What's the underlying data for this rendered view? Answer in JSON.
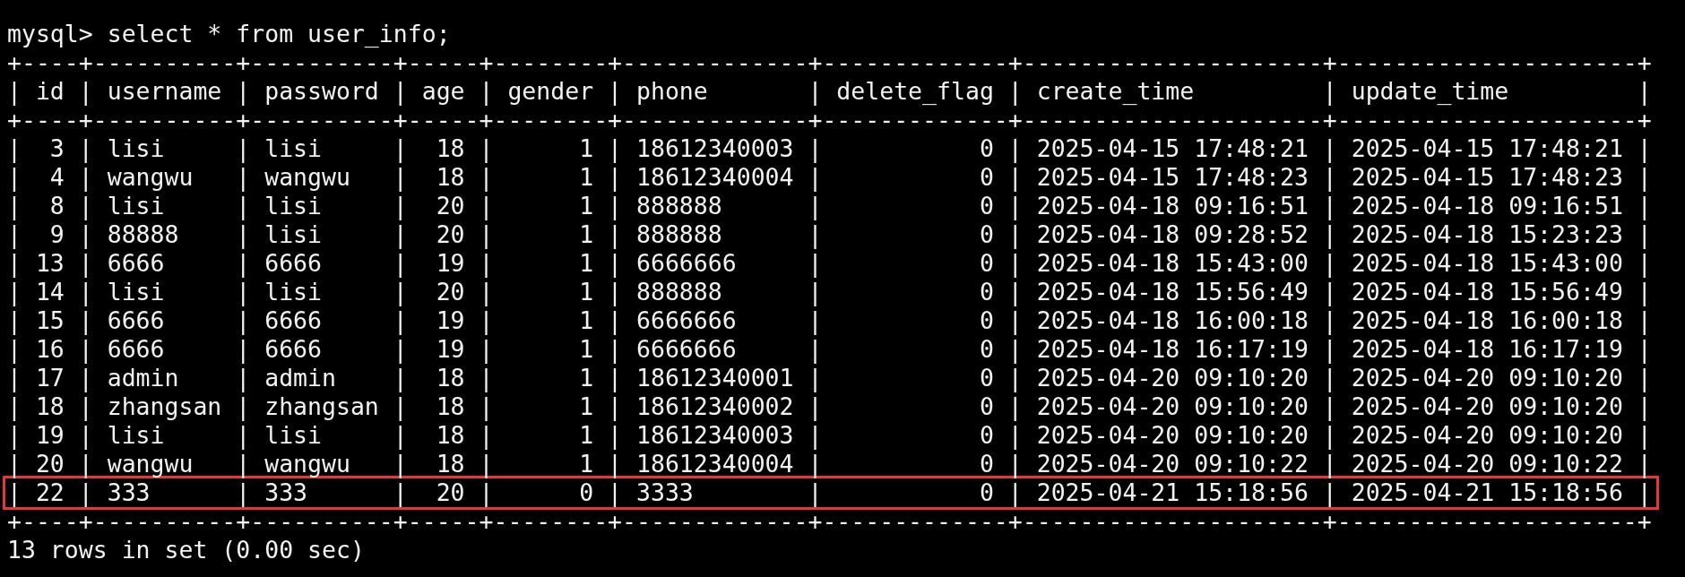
{
  "prompt": "mysql> select * from user_info;",
  "table": {
    "separator_char": "|",
    "top_border": "+----+----------+----------+-----+--------+-------------+-------------+---------------------+---------------------+",
    "header_border": "+----+----------+----------+-----+--------+-------------+-------------+---------------------+---------------------+",
    "bottom_border": "+----+----------+----------+-----+--------+-------------+-------------+---------------------+---------------------+",
    "columns": [
      {
        "name": "id",
        "kind": "numeric"
      },
      {
        "name": "username",
        "kind": "text"
      },
      {
        "name": "password",
        "kind": "text"
      },
      {
        "name": "age",
        "kind": "numeric"
      },
      {
        "name": "gender",
        "kind": "numeric"
      },
      {
        "name": "phone",
        "kind": "text"
      },
      {
        "name": "delete_flag",
        "kind": "numeric"
      },
      {
        "name": "create_time",
        "kind": "text"
      },
      {
        "name": "update_time",
        "kind": "text"
      }
    ],
    "rows": [
      {
        "cells": [
          "3",
          "lisi",
          "lisi",
          "18",
          "1",
          "18612340003",
          "0",
          "2025-04-15 17:48:21",
          "2025-04-15 17:48:21"
        ],
        "highlighted": false
      },
      {
        "cells": [
          "4",
          "wangwu",
          "wangwu",
          "18",
          "1",
          "18612340004",
          "0",
          "2025-04-15 17:48:23",
          "2025-04-15 17:48:23"
        ],
        "highlighted": false
      },
      {
        "cells": [
          "8",
          "lisi",
          "lisi",
          "20",
          "1",
          "888888",
          "0",
          "2025-04-18 09:16:51",
          "2025-04-18 09:16:51"
        ],
        "highlighted": false
      },
      {
        "cells": [
          "9",
          "88888",
          "lisi",
          "20",
          "1",
          "888888",
          "0",
          "2025-04-18 09:28:52",
          "2025-04-18 15:23:23"
        ],
        "highlighted": false
      },
      {
        "cells": [
          "13",
          "6666",
          "6666",
          "19",
          "1",
          "6666666",
          "0",
          "2025-04-18 15:43:00",
          "2025-04-18 15:43:00"
        ],
        "highlighted": false
      },
      {
        "cells": [
          "14",
          "lisi",
          "lisi",
          "20",
          "1",
          "888888",
          "0",
          "2025-04-18 15:56:49",
          "2025-04-18 15:56:49"
        ],
        "highlighted": false
      },
      {
        "cells": [
          "15",
          "6666",
          "6666",
          "19",
          "1",
          "6666666",
          "0",
          "2025-04-18 16:00:18",
          "2025-04-18 16:00:18"
        ],
        "highlighted": false
      },
      {
        "cells": [
          "16",
          "6666",
          "6666",
          "19",
          "1",
          "6666666",
          "0",
          "2025-04-18 16:17:19",
          "2025-04-18 16:17:19"
        ],
        "highlighted": false
      },
      {
        "cells": [
          "17",
          "admin",
          "admin",
          "18",
          "1",
          "18612340001",
          "0",
          "2025-04-20 09:10:20",
          "2025-04-20 09:10:20"
        ],
        "highlighted": false
      },
      {
        "cells": [
          "18",
          "zhangsan",
          "zhangsan",
          "18",
          "1",
          "18612340002",
          "0",
          "2025-04-20 09:10:20",
          "2025-04-20 09:10:20"
        ],
        "highlighted": false
      },
      {
        "cells": [
          "19",
          "lisi",
          "lisi",
          "18",
          "1",
          "18612340003",
          "0",
          "2025-04-20 09:10:20",
          "2025-04-20 09:10:20"
        ],
        "highlighted": false
      },
      {
        "cells": [
          "20",
          "wangwu",
          "wangwu",
          "18",
          "1",
          "18612340004",
          "0",
          "2025-04-20 09:10:22",
          "2025-04-20 09:10:22"
        ],
        "highlighted": false
      },
      {
        "cells": [
          "22",
          "333",
          "333",
          "20",
          "0",
          "3333",
          "0",
          "2025-04-21 15:18:56",
          "2025-04-21 15:18:56"
        ],
        "highlighted": true
      }
    ]
  },
  "result_line": "13 rows in set (0.00 sec)"
}
